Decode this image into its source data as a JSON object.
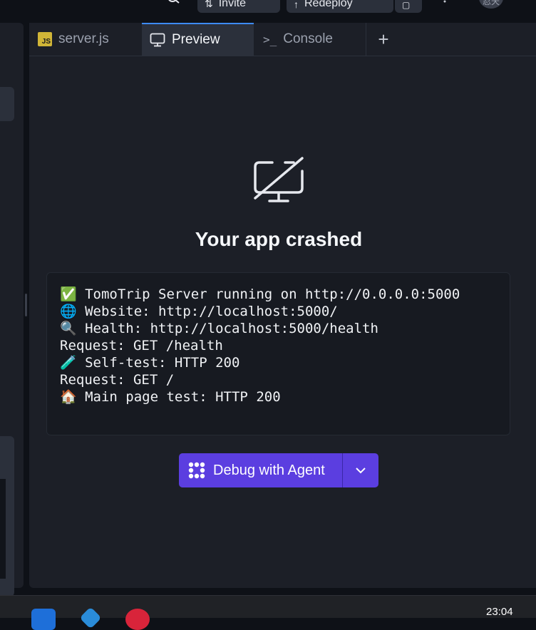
{
  "header": {
    "invite_label": "Invite",
    "redeploy_label": "Redeploy",
    "avatar_text": "忍天"
  },
  "tabs": [
    {
      "label": "server.js",
      "icon": "js-file-icon",
      "active": false
    },
    {
      "label": "Preview",
      "icon": "monitor-icon",
      "active": true
    },
    {
      "label": "Console",
      "icon": "terminal-icon",
      "active": false
    }
  ],
  "preview": {
    "title": "Your app crashed",
    "icon": "monitor-off-icon",
    "log_lines": [
      "✅ TomoTrip Server running on http://0.0.0.0:5000",
      "🌐 Website: http://localhost:5000/",
      "🔍 Health: http://localhost:5000/health",
      "Request: GET /health",
      "🧪 Self-test: HTTP 200",
      "Request: GET /",
      "🏠 Main page test: HTTP 200"
    ],
    "debug_button_label": "Debug with Agent"
  },
  "taskbar": {
    "clock": "23:04"
  },
  "colors": {
    "accent": "#5b3ee0",
    "active_tab_border": "#3d8bfd",
    "background": "#0e1117",
    "panel": "#1c1f27"
  }
}
